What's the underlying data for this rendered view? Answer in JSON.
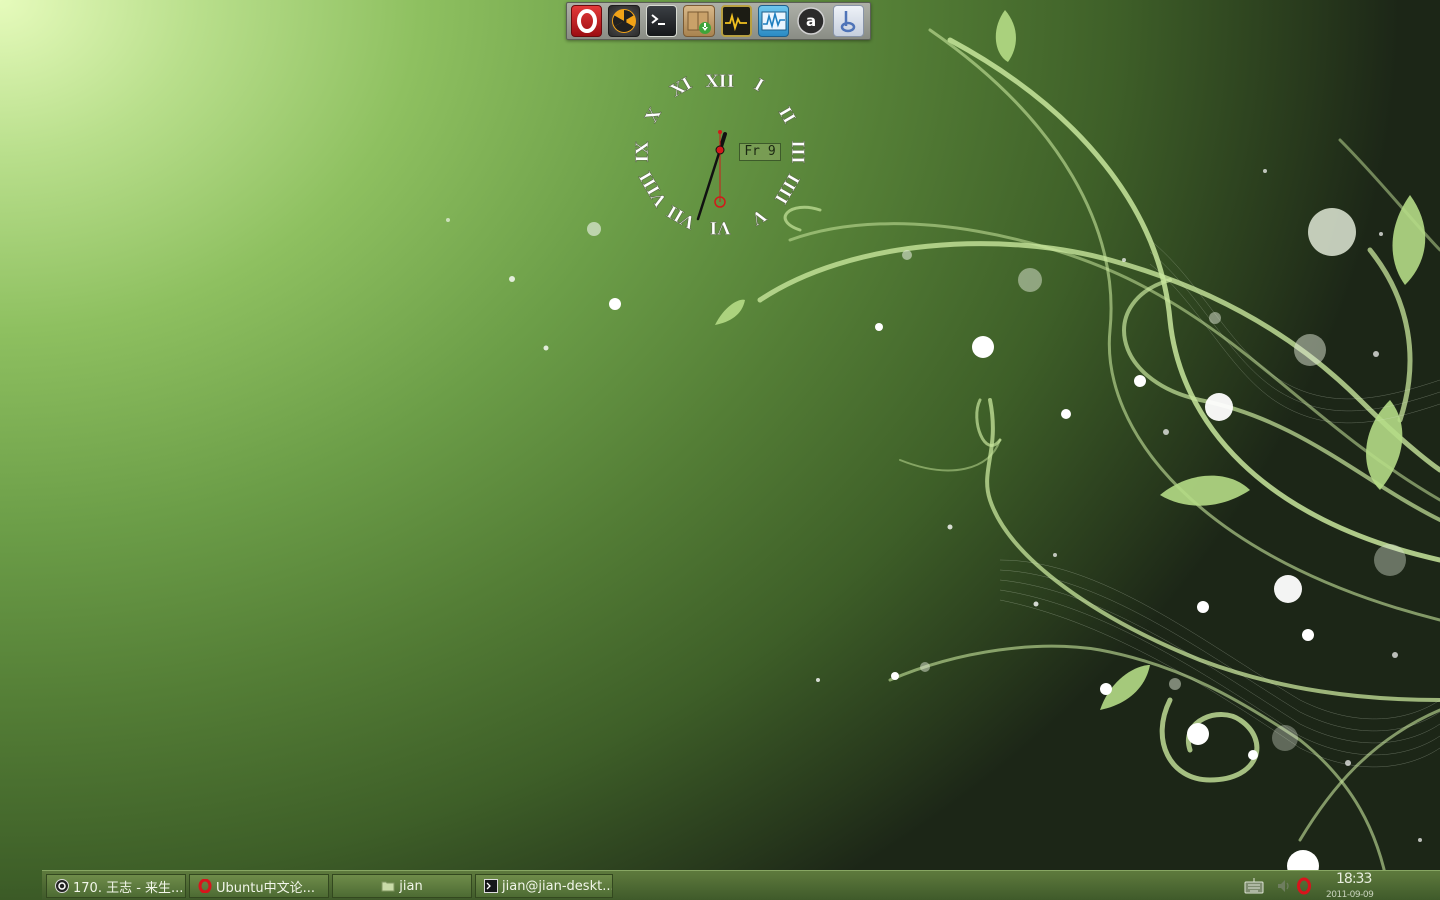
{
  "dock": {
    "launchers": [
      {
        "name": "opera-browser",
        "icon": "opera-icon"
      },
      {
        "name": "radiation-app",
        "icon": "radiation-icon"
      },
      {
        "name": "terminal",
        "icon": "terminal-icon"
      },
      {
        "name": "package-installer",
        "icon": "package-icon"
      },
      {
        "name": "system-monitor",
        "icon": "activity-monitor-icon"
      },
      {
        "name": "network-monitor",
        "icon": "waveform-icon"
      },
      {
        "name": "font-app",
        "icon": "letter-a-icon"
      },
      {
        "name": "music-player",
        "icon": "music-note-icon"
      }
    ]
  },
  "clock_widget": {
    "numerals": [
      "XII",
      "I",
      "II",
      "III",
      "IIII",
      "V",
      "VI",
      "VII",
      "VIII",
      "IX",
      "X",
      "XI"
    ],
    "date_label": "Fr 9",
    "time": "18:33"
  },
  "taskbar": {
    "tasks": [
      {
        "label": "170. 王志 - 来生...",
        "icon": "media-player-icon"
      },
      {
        "label": "Ubuntu中文论...",
        "icon": "opera-icon"
      },
      {
        "label": "jian",
        "icon": "folder-icon"
      },
      {
        "label": "jian@jian-deskt...",
        "icon": "terminal-icon"
      }
    ],
    "tray": {
      "time": "18:33",
      "date": "2011-09-09"
    }
  },
  "colors": {
    "panel_green": "#4d6b33",
    "dock_gray": "#9c9e96",
    "clock_hand_red": "#d21a1a",
    "opera_red": "#c8141c"
  }
}
